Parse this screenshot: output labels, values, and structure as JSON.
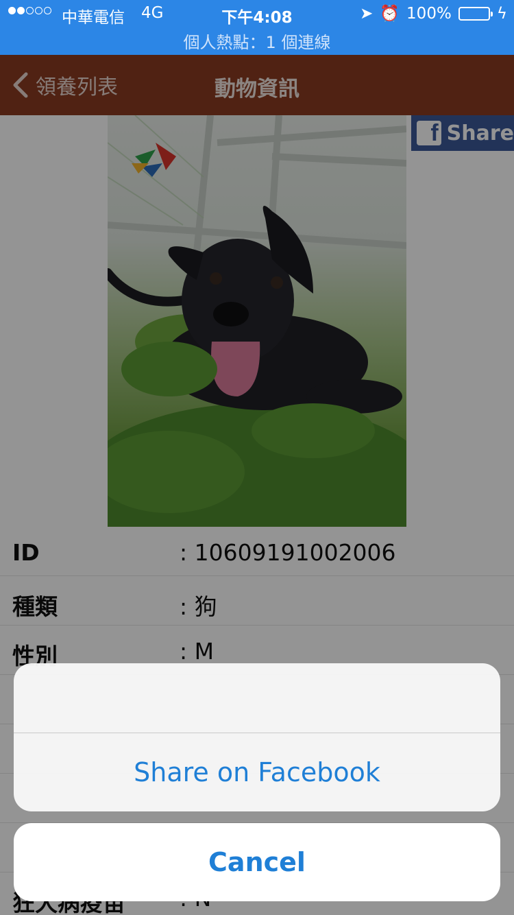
{
  "status_bar": {
    "carrier": "中華電信",
    "network": "4G",
    "time": "下午4:08",
    "battery": "100%",
    "hotspot": "個人熱點：1 個連線"
  },
  "nav": {
    "back_label": "領養列表",
    "title": "動物資訊"
  },
  "share_button": {
    "label": "Share"
  },
  "photo": {
    "description_icon": "dog-photo"
  },
  "details": [
    {
      "label": "ID",
      "value": ": 10609191002006"
    },
    {
      "label": "種類",
      "value": ": 狗"
    },
    {
      "label": "性別",
      "value": ": M"
    },
    {
      "label": "",
      "value": ""
    },
    {
      "label": "",
      "value": ""
    },
    {
      "label": "",
      "value": ""
    },
    {
      "label": "",
      "value": ""
    },
    {
      "label": "狂犬病疫苗",
      "value": ": N"
    }
  ],
  "action_sheet": {
    "share_label": "Share on Facebook",
    "cancel_label": "Cancel"
  },
  "colors": {
    "status_bar": "#2c86e6",
    "nav_bar": "#8a3b22",
    "facebook": "#3b5998",
    "action_text": "#1f7fd6"
  }
}
